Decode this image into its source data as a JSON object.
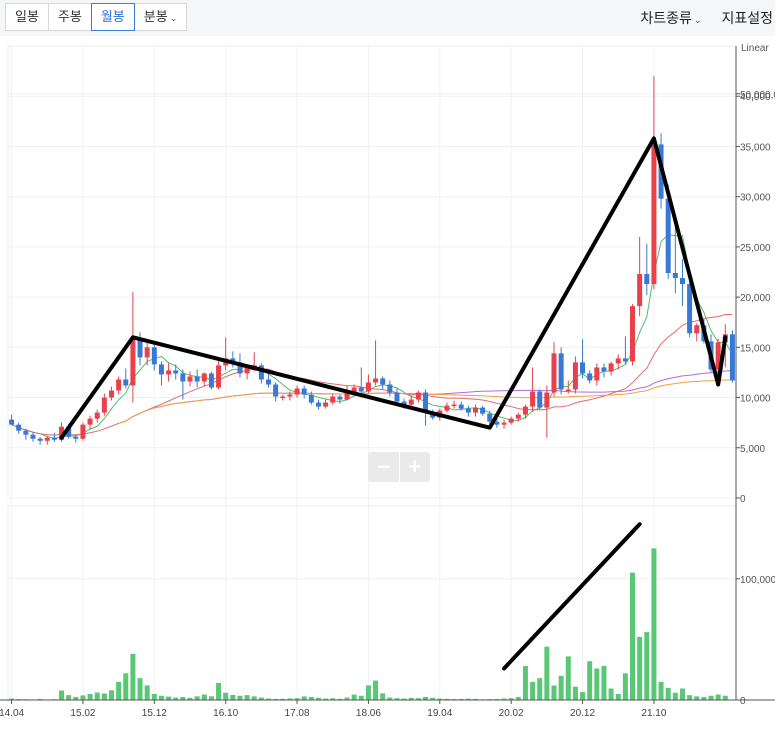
{
  "toolbar": {
    "tabs": [
      {
        "label": "일봉",
        "active": false
      },
      {
        "label": "주봉",
        "active": false
      },
      {
        "label": "월봉",
        "active": true
      },
      {
        "label": "분봉",
        "active": false,
        "dropdown": true
      }
    ],
    "chart_type_label": "차트종류",
    "indicator_label": "지표설정",
    "chevron_icon": "chevron-down-icon"
  },
  "zoom": {
    "minus_icon": "minus-icon",
    "plus_icon": "plus-icon"
  },
  "colors": {
    "up": "#e8414c",
    "down": "#3a78d6",
    "volume": "#59c776",
    "ma5": "#4cbf6a",
    "ma20": "#e36a6a",
    "ma60": "#b26ae0",
    "ma120": "#f0a040",
    "annotation": "#000000"
  },
  "chart_data": {
    "type": "candlestick",
    "scale_label": "Linear",
    "price_ticks": [
      "0",
      "5,000",
      "10,000",
      "15,000",
      "20,000",
      "25,000",
      "30,000",
      "35,000",
      "40,000"
    ],
    "price_range": [
      0,
      45000
    ],
    "volume_ticks": [
      "0",
      "50,000,0",
      "100,000"
    ],
    "volume_range": [
      0,
      160000
    ],
    "x_tick_labels": [
      "14.04",
      "15.02",
      "15.12",
      "16.10",
      "17.08",
      "18.06",
      "19.04",
      "20.02",
      "20.12",
      "21.10"
    ],
    "candles": [
      {
        "o": 7800,
        "h": 8300,
        "l": 7300,
        "c": 7300
      },
      {
        "o": 7300,
        "h": 7500,
        "l": 6400,
        "c": 6700
      },
      {
        "o": 6700,
        "h": 6900,
        "l": 5800,
        "c": 6300
      },
      {
        "o": 6300,
        "h": 6600,
        "l": 5600,
        "c": 5900
      },
      {
        "o": 5900,
        "h": 6100,
        "l": 5300,
        "c": 5700
      },
      {
        "o": 5700,
        "h": 6200,
        "l": 5300,
        "c": 6000
      },
      {
        "o": 6000,
        "h": 6500,
        "l": 5600,
        "c": 5800
      },
      {
        "o": 5800,
        "h": 7500,
        "l": 5600,
        "c": 7100
      },
      {
        "o": 7100,
        "h": 7400,
        "l": 5900,
        "c": 6100
      },
      {
        "o": 6100,
        "h": 6300,
        "l": 5500,
        "c": 5900
      },
      {
        "o": 5900,
        "h": 7500,
        "l": 5700,
        "c": 7300
      },
      {
        "o": 7300,
        "h": 8200,
        "l": 6900,
        "c": 7900
      },
      {
        "o": 7900,
        "h": 8800,
        "l": 7500,
        "c": 8500
      },
      {
        "o": 8500,
        "h": 10400,
        "l": 8200,
        "c": 10000
      },
      {
        "o": 10000,
        "h": 11100,
        "l": 9700,
        "c": 10700
      },
      {
        "o": 10700,
        "h": 12100,
        "l": 10300,
        "c": 11800
      },
      {
        "o": 11800,
        "h": 12900,
        "l": 10900,
        "c": 11200
      },
      {
        "o": 11200,
        "h": 20500,
        "l": 9500,
        "c": 15900
      },
      {
        "o": 15900,
        "h": 16500,
        "l": 13200,
        "c": 14000
      },
      {
        "o": 14000,
        "h": 15600,
        "l": 13200,
        "c": 15000
      },
      {
        "o": 15000,
        "h": 15300,
        "l": 12700,
        "c": 13300
      },
      {
        "o": 13300,
        "h": 13600,
        "l": 11200,
        "c": 12300
      },
      {
        "o": 12300,
        "h": 13400,
        "l": 11600,
        "c": 12700
      },
      {
        "o": 12700,
        "h": 13300,
        "l": 11800,
        "c": 12400
      },
      {
        "o": 12400,
        "h": 12800,
        "l": 9800,
        "c": 11600
      },
      {
        "o": 11600,
        "h": 12600,
        "l": 11100,
        "c": 12100
      },
      {
        "o": 12100,
        "h": 12800,
        "l": 11000,
        "c": 11600
      },
      {
        "o": 11600,
        "h": 12500,
        "l": 11100,
        "c": 12400
      },
      {
        "o": 12400,
        "h": 12600,
        "l": 10800,
        "c": 11000
      },
      {
        "o": 11000,
        "h": 13800,
        "l": 10800,
        "c": 13200
      },
      {
        "o": 13200,
        "h": 16000,
        "l": 12700,
        "c": 13900
      },
      {
        "o": 13900,
        "h": 14600,
        "l": 13000,
        "c": 13500
      },
      {
        "o": 13500,
        "h": 14400,
        "l": 12000,
        "c": 12400
      },
      {
        "o": 12400,
        "h": 13200,
        "l": 11800,
        "c": 13000
      },
      {
        "o": 13000,
        "h": 14500,
        "l": 12600,
        "c": 13200
      },
      {
        "o": 13200,
        "h": 13400,
        "l": 11400,
        "c": 11800
      },
      {
        "o": 11800,
        "h": 12400,
        "l": 11000,
        "c": 11300
      },
      {
        "o": 11300,
        "h": 11500,
        "l": 9600,
        "c": 10100
      },
      {
        "o": 10100,
        "h": 10300,
        "l": 9700,
        "c": 10100
      },
      {
        "o": 10100,
        "h": 10600,
        "l": 9700,
        "c": 10300
      },
      {
        "o": 10300,
        "h": 11200,
        "l": 10000,
        "c": 10900
      },
      {
        "o": 10900,
        "h": 11200,
        "l": 9900,
        "c": 10300
      },
      {
        "o": 10300,
        "h": 10600,
        "l": 9300,
        "c": 9500
      },
      {
        "o": 9500,
        "h": 9800,
        "l": 8800,
        "c": 9100
      },
      {
        "o": 9100,
        "h": 9800,
        "l": 8900,
        "c": 9500
      },
      {
        "o": 9500,
        "h": 10400,
        "l": 9300,
        "c": 10100
      },
      {
        "o": 10100,
        "h": 10300,
        "l": 9400,
        "c": 9800
      },
      {
        "o": 9800,
        "h": 11200,
        "l": 9700,
        "c": 10500
      },
      {
        "o": 10500,
        "h": 11300,
        "l": 10100,
        "c": 11000
      },
      {
        "o": 11000,
        "h": 13000,
        "l": 10200,
        "c": 10600
      },
      {
        "o": 10600,
        "h": 12300,
        "l": 10400,
        "c": 11500
      },
      {
        "o": 11500,
        "h": 15700,
        "l": 11200,
        "c": 11900
      },
      {
        "o": 11900,
        "h": 12100,
        "l": 10800,
        "c": 11300
      },
      {
        "o": 11300,
        "h": 11700,
        "l": 10100,
        "c": 10500
      },
      {
        "o": 10500,
        "h": 10900,
        "l": 9300,
        "c": 9600
      },
      {
        "o": 9600,
        "h": 9900,
        "l": 8900,
        "c": 9300
      },
      {
        "o": 9300,
        "h": 10200,
        "l": 9000,
        "c": 9800
      },
      {
        "o": 9800,
        "h": 10700,
        "l": 9500,
        "c": 10500
      },
      {
        "o": 10500,
        "h": 10800,
        "l": 7200,
        "c": 8600
      },
      {
        "o": 8600,
        "h": 8800,
        "l": 7800,
        "c": 8000
      },
      {
        "o": 8000,
        "h": 8900,
        "l": 7700,
        "c": 8700
      },
      {
        "o": 8700,
        "h": 9500,
        "l": 8500,
        "c": 9200
      },
      {
        "o": 9200,
        "h": 9700,
        "l": 8900,
        "c": 9300
      },
      {
        "o": 9300,
        "h": 9600,
        "l": 8700,
        "c": 8900
      },
      {
        "o": 8900,
        "h": 9200,
        "l": 8100,
        "c": 8500
      },
      {
        "o": 8500,
        "h": 9300,
        "l": 8100,
        "c": 9000
      },
      {
        "o": 9000,
        "h": 9200,
        "l": 8200,
        "c": 8400
      },
      {
        "o": 8400,
        "h": 8700,
        "l": 7300,
        "c": 7600
      },
      {
        "o": 7600,
        "h": 7900,
        "l": 7000,
        "c": 7300
      },
      {
        "o": 7300,
        "h": 7800,
        "l": 6900,
        "c": 7500
      },
      {
        "o": 7500,
        "h": 8100,
        "l": 7300,
        "c": 7900
      },
      {
        "o": 7900,
        "h": 8500,
        "l": 7600,
        "c": 8300
      },
      {
        "o": 8300,
        "h": 9300,
        "l": 7900,
        "c": 9100
      },
      {
        "o": 9100,
        "h": 13000,
        "l": 8600,
        "c": 10600
      },
      {
        "o": 10600,
        "h": 10800,
        "l": 8800,
        "c": 9000
      },
      {
        "o": 9000,
        "h": 11200,
        "l": 6000,
        "c": 10500
      },
      {
        "o": 10500,
        "h": 15500,
        "l": 10100,
        "c": 14400
      },
      {
        "o": 14400,
        "h": 15000,
        "l": 10300,
        "c": 10800
      },
      {
        "o": 10800,
        "h": 11700,
        "l": 10400,
        "c": 10800
      },
      {
        "o": 10800,
        "h": 14100,
        "l": 10400,
        "c": 13500
      },
      {
        "o": 13500,
        "h": 15800,
        "l": 11900,
        "c": 12400
      },
      {
        "o": 12400,
        "h": 12700,
        "l": 11400,
        "c": 11700
      },
      {
        "o": 11700,
        "h": 13400,
        "l": 11200,
        "c": 13000
      },
      {
        "o": 13000,
        "h": 13400,
        "l": 12000,
        "c": 12600
      },
      {
        "o": 12600,
        "h": 13600,
        "l": 12200,
        "c": 13400
      },
      {
        "o": 13400,
        "h": 14300,
        "l": 12800,
        "c": 13900
      },
      {
        "o": 13900,
        "h": 16100,
        "l": 13300,
        "c": 13600
      },
      {
        "o": 13600,
        "h": 19300,
        "l": 13200,
        "c": 19100
      },
      {
        "o": 19100,
        "h": 26000,
        "l": 18100,
        "c": 22300
      },
      {
        "o": 22300,
        "h": 25300,
        "l": 20200,
        "c": 21300
      },
      {
        "o": 21300,
        "h": 42000,
        "l": 20800,
        "c": 35200
      },
      {
        "o": 35200,
        "h": 36300,
        "l": 28800,
        "c": 29800
      },
      {
        "o": 29800,
        "h": 31200,
        "l": 21800,
        "c": 22400
      },
      {
        "o": 22400,
        "h": 27600,
        "l": 20400,
        "c": 21900
      },
      {
        "o": 21900,
        "h": 23800,
        "l": 19100,
        "c": 21300
      },
      {
        "o": 21300,
        "h": 22400,
        "l": 16000,
        "c": 16400
      },
      {
        "o": 16400,
        "h": 17400,
        "l": 15600,
        "c": 17200
      },
      {
        "o": 17200,
        "h": 17800,
        "l": 15400,
        "c": 15600
      },
      {
        "o": 15600,
        "h": 16300,
        "l": 12500,
        "c": 12800
      },
      {
        "o": 12800,
        "h": 15900,
        "l": 11600,
        "c": 15500
      },
      {
        "o": 15500,
        "h": 17300,
        "l": 13000,
        "c": 16300
      },
      {
        "o": 16300,
        "h": 16700,
        "l": 11500,
        "c": 11700
      }
    ],
    "volumes": [
      1200,
      800,
      600,
      500,
      900,
      400,
      700,
      7800,
      4000,
      2500,
      3800,
      5000,
      6200,
      5400,
      8000,
      15000,
      22000,
      38000,
      18000,
      12000,
      5000,
      3500,
      2800,
      2000,
      2500,
      1800,
      3000,
      4500,
      3000,
      14000,
      6000,
      4200,
      3500,
      4000,
      3000,
      2000,
      1200,
      900,
      1000,
      1300,
      1500,
      3000,
      2500,
      1800,
      1200,
      1400,
      1000,
      2000,
      4500,
      3500,
      12000,
      16000,
      5500,
      2000,
      1500,
      1200,
      1800,
      1500,
      2500,
      1800,
      1200,
      1000,
      800,
      900,
      1100,
      900,
      600,
      700,
      800,
      1200,
      1500,
      2500,
      28000,
      15000,
      18000,
      44000,
      12000,
      20000,
      36000,
      11000,
      6500,
      32000,
      26000,
      28000,
      9500,
      5000,
      22000,
      105000,
      52000,
      56000,
      125000,
      15000,
      10000,
      6000,
      9500,
      4000,
      3000,
      2500,
      3500,
      4500,
      3500
    ]
  }
}
